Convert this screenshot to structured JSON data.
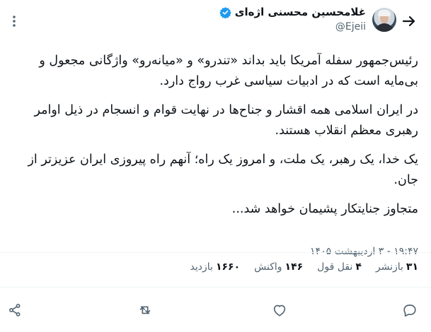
{
  "header": {
    "author_name": "غلامحسین محسنی اژه‌ای",
    "handle": "@Ejeii"
  },
  "tweet": {
    "paragraphs": [
      "رئیس‌جمهور سفله آمریکا باید بداند «تندرو» و «میانه‌رو» واژگانی مجعول و بی‌مایه است که در ادبیات سیاسی غرب رواج دارد.",
      "در ایران اسلامی همه اقشار و جناح‌ها در نهایت قوام و انسجام در ذیل اوامر رهبری معظم انقلاب هستند.",
      "یک خدا، یک رهبر، یک ملت، و امروز یک راه؛ آنهم راه پیروزی ایران عزیزتر از جان.",
      "متجاوز جنایتکار پشیمان خواهد شد..."
    ],
    "timestamp": "۱۹:۴۷ - ۳ اردیبهشت ۱۴۰۵"
  },
  "stats": [
    {
      "value": "۳۱",
      "label": "بازنشر"
    },
    {
      "value": "۴",
      "label": "نقل قول"
    },
    {
      "value": "۱۴۶",
      "label": "واکنش"
    },
    {
      "value": "۱۶۶۰",
      "label": "بازدید"
    }
  ],
  "colors": {
    "verified": "#1d9bf0",
    "text": "#0f1419",
    "secondary": "#536471",
    "divider": "#eff3f4"
  },
  "icons": {
    "back": "arrow-right-icon",
    "more": "more-vertical-icon",
    "verified": "verified-badge-icon",
    "reply": "reply-icon",
    "retweet": "retweet-icon",
    "like": "heart-icon",
    "bookmark": "bookmark-icon",
    "share": "share-icon"
  }
}
